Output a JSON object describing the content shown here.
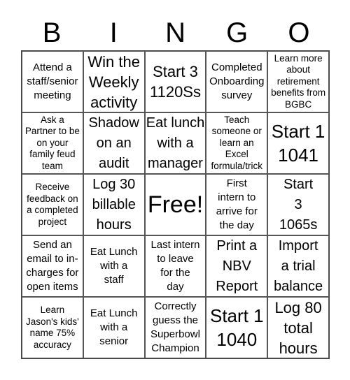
{
  "header": {
    "letters": [
      "B",
      "I",
      "N",
      "G",
      "O"
    ]
  },
  "cells": [
    {
      "text": "Attend a\nstaff/senior\nmeeting",
      "size": "s15"
    },
    {
      "text": "Win the\nWeekly\nactivity",
      "size": "s22"
    },
    {
      "text": "Start 3\n1120Ss",
      "size": "s22"
    },
    {
      "text": "Completed\nOnboarding\nsurvey",
      "size": "s15"
    },
    {
      "text": "Learn more\nabout\nretirement\nbenefits from\nBGBC",
      "size": "s13"
    },
    {
      "text": "Ask a\nPartner to be\non your\nfamily feud\nteam",
      "size": "s13"
    },
    {
      "text": "Shadow\non an\naudit",
      "size": "s20"
    },
    {
      "text": "Eat lunch\nwith a\nmanager",
      "size": "s20"
    },
    {
      "text": "Teach\nsomeone or\nlearn an\nExcel\nformula/trick",
      "size": "s13"
    },
    {
      "text": "Start 1\n1041",
      "size": "s26"
    },
    {
      "text": "Receive\nfeedback on\na completed\nproject",
      "size": "s13"
    },
    {
      "text": "Log 30\nbillable\nhours",
      "size": "s20"
    },
    {
      "text": "Free!",
      "size": "s34"
    },
    {
      "text": "First\nintern to\narrive for\nthe day",
      "size": "s15"
    },
    {
      "text": "Start\n3\n1065s",
      "size": "s20"
    },
    {
      "text": "Send an\nemail to in-\ncharges for\nopen items",
      "size": "s15"
    },
    {
      "text": "Eat Lunch\nwith a\nstaff",
      "size": "s15"
    },
    {
      "text": "Last intern\nto leave\nfor the\nday",
      "size": "s15"
    },
    {
      "text": "Print a\nNBV\nReport",
      "size": "s20"
    },
    {
      "text": "Import\na trial\nbalance",
      "size": "s20"
    },
    {
      "text": "Learn\nJason's kids'\nname 75%\naccuracy",
      "size": "s13"
    },
    {
      "text": "Eat Lunch\nwith a\nsenior",
      "size": "s15"
    },
    {
      "text": "Correctly\nguess the\nSuperbowl\nChampion",
      "size": "s15"
    },
    {
      "text": "Start 1\n1040",
      "size": "s26"
    },
    {
      "text": "Log 80\ntotal\nhours",
      "size": "s22"
    }
  ]
}
